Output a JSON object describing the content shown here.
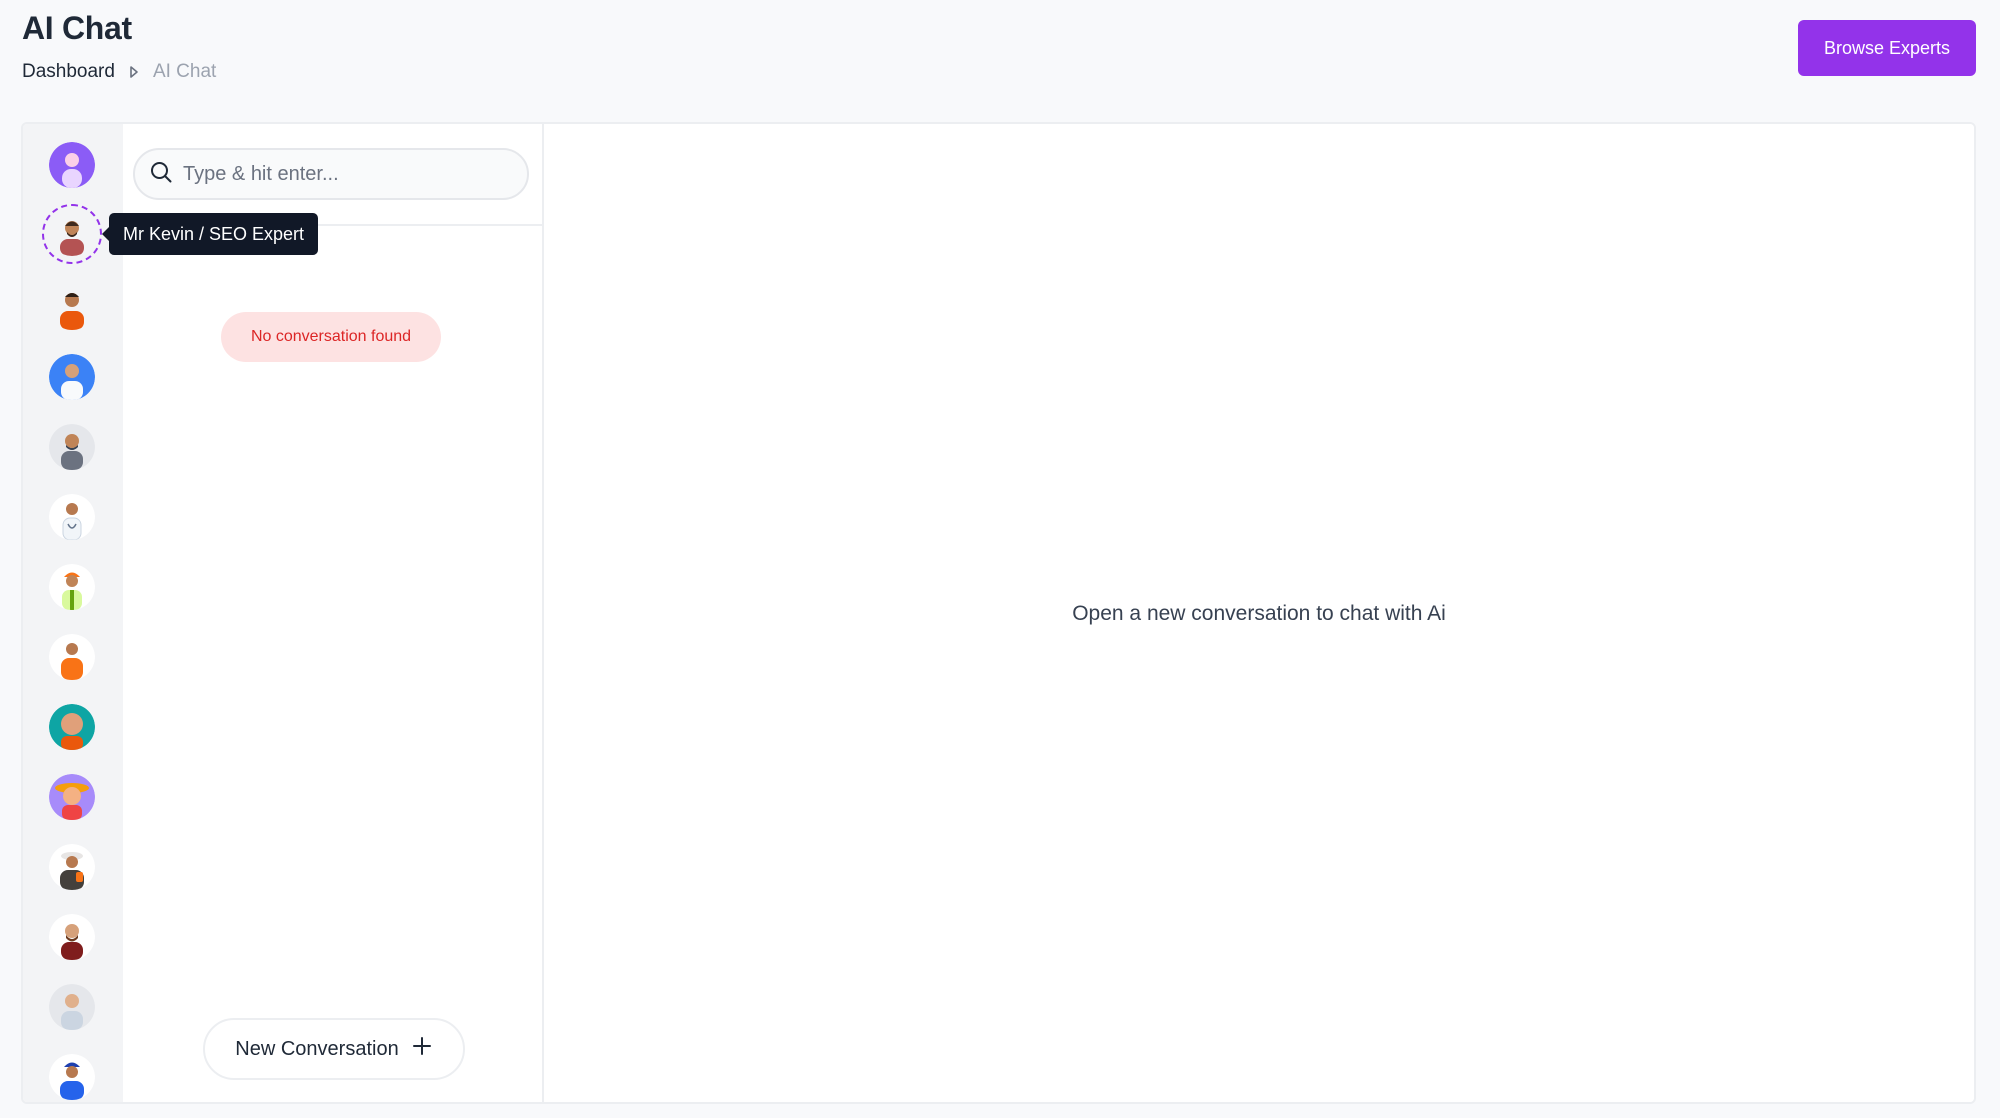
{
  "header": {
    "title": "AI Chat",
    "breadcrumb": [
      "Dashboard",
      "AI Chat"
    ],
    "browse_label": "Browse Experts"
  },
  "colors": {
    "accent": "#9333ea",
    "danger_text": "#dc2626",
    "danger_bg": "#fde2e2"
  },
  "experts": {
    "tooltip": "Mr Kevin / SEO Expert",
    "active_index": 1
  },
  "conversations": {
    "search_placeholder": "Type & hit enter...",
    "empty_message": "No conversation found",
    "new_label": "New Conversation"
  },
  "chat": {
    "empty_message": "Open a new conversation to chat with Ai"
  }
}
